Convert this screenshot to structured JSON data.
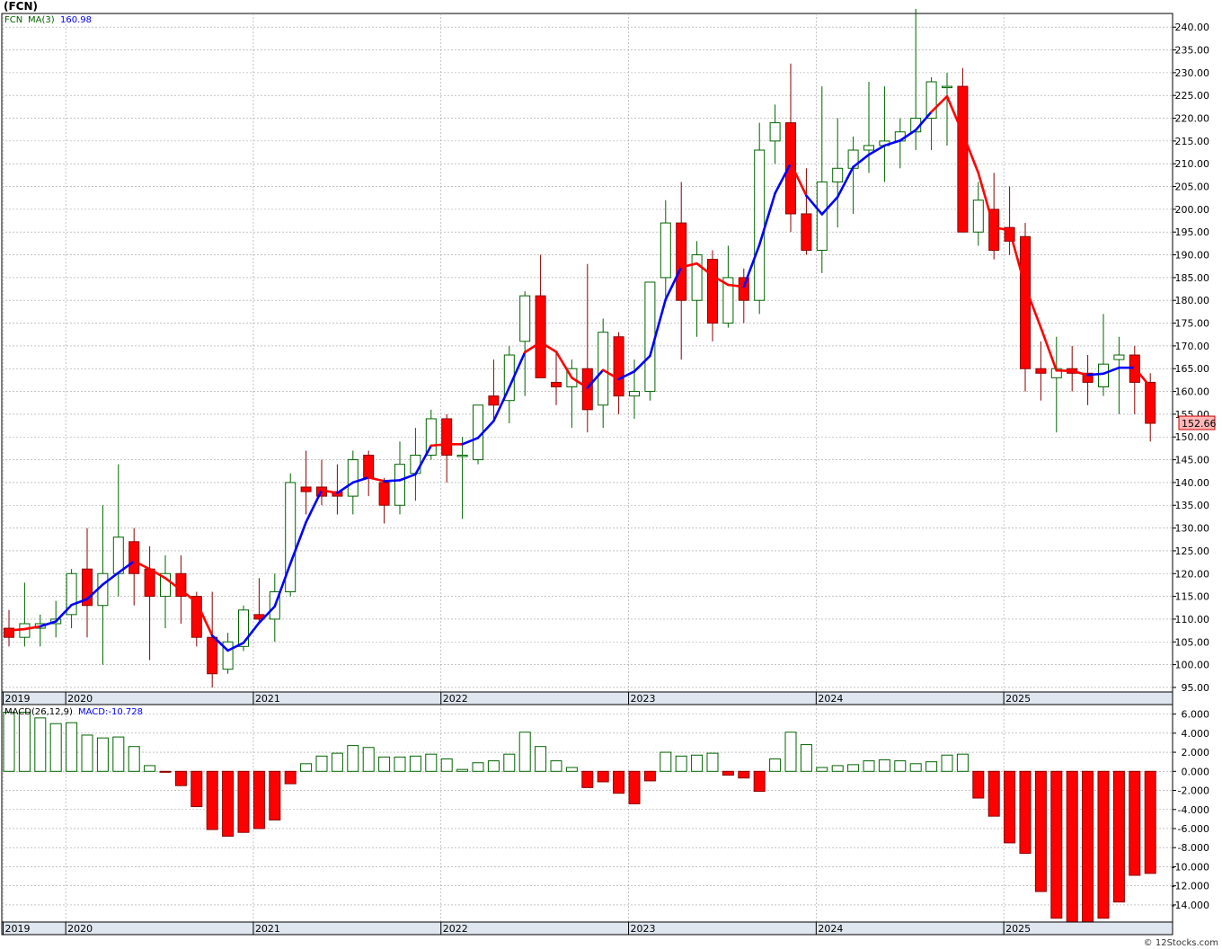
{
  "symbol_title": "(FCN)",
  "watermark": "© 12Stocks.com",
  "colors": {
    "up_fill": "#ffffff",
    "up_stroke": "#006400",
    "down_fill": "#ff0000",
    "down_stroke": "#8b0000",
    "wick": "#006400",
    "ma_up": "#0000ff",
    "ma_down": "#ff0000",
    "grid": "#a0a0a0",
    "last_price_bg": "#ffb6b6"
  },
  "chart_data": [
    {
      "type": "candlestick",
      "name": "price",
      "legend": {
        "symbol": "FCN",
        "ma_label": "MA(3)",
        "ma_value": "160.98"
      },
      "last_price_label": "152.66",
      "y_ticks": [
        "95.00",
        "100.00",
        "105.00",
        "110.00",
        "115.00",
        "120.00",
        "125.00",
        "130.00",
        "135.00",
        "140.00",
        "145.00",
        "150.00",
        "155.00",
        "160.00",
        "165.00",
        "170.00",
        "175.00",
        "180.00",
        "185.00",
        "190.00",
        "195.00",
        "200.00",
        "205.00",
        "210.00",
        "215.00",
        "220.00",
        "225.00",
        "230.00",
        "235.00",
        "240.00"
      ],
      "ylim": [
        94,
        243
      ],
      "x_labels": [
        "2019",
        "2020",
        "2021",
        "2022",
        "2023",
        "2024",
        "2025"
      ],
      "x_label_index": [
        -0.4,
        3.6,
        15.6,
        27.6,
        39.6,
        51.6,
        63.6
      ],
      "candles": [
        [
          108,
          112,
          104,
          106
        ],
        [
          106,
          118,
          104,
          109
        ],
        [
          108,
          111,
          104,
          109
        ],
        [
          109,
          114,
          106,
          110
        ],
        [
          111,
          121,
          108,
          120
        ],
        [
          121,
          130,
          106,
          113
        ],
        [
          113,
          135,
          100,
          120
        ],
        [
          120,
          144,
          115,
          128
        ],
        [
          127,
          130,
          113,
          120
        ],
        [
          121,
          126,
          101,
          115
        ],
        [
          115,
          124,
          108,
          120
        ],
        [
          120,
          124,
          109,
          115
        ],
        [
          115,
          116,
          104,
          106
        ],
        [
          106,
          116,
          95,
          98
        ],
        [
          99,
          107,
          98,
          105
        ],
        [
          104,
          113,
          103,
          112
        ],
        [
          111,
          119,
          109,
          110
        ],
        [
          110,
          120,
          105,
          116
        ],
        [
          116,
          142,
          115,
          140
        ],
        [
          139,
          147,
          133,
          138
        ],
        [
          139,
          145,
          135,
          137
        ],
        [
          138,
          144,
          133,
          137
        ],
        [
          137,
          147,
          133,
          145
        ],
        [
          146,
          147,
          137,
          141
        ],
        [
          140,
          141,
          131,
          135
        ],
        [
          135,
          149,
          133,
          144
        ],
        [
          142,
          152,
          136,
          146
        ],
        [
          146,
          156,
          145,
          154
        ],
        [
          154,
          155,
          140,
          146
        ],
        [
          146,
          150,
          132,
          146
        ],
        [
          145,
          157,
          144,
          157
        ],
        [
          159,
          167,
          154,
          157
        ],
        [
          158,
          170,
          153,
          168
        ],
        [
          171,
          182,
          159,
          181
        ],
        [
          181,
          190,
          163,
          163
        ],
        [
          162,
          169,
          157,
          161
        ],
        [
          161,
          167,
          152,
          165
        ],
        [
          165,
          188,
          151,
          156
        ],
        [
          157,
          176,
          152,
          173
        ],
        [
          172,
          173,
          155,
          159
        ],
        [
          159,
          167,
          154,
          160
        ],
        [
          160,
          184,
          158,
          184
        ],
        [
          185,
          202,
          180,
          197
        ],
        [
          197,
          206,
          167,
          180
        ],
        [
          180,
          193,
          172,
          190
        ],
        [
          189,
          191,
          171,
          175
        ],
        [
          175,
          192,
          174,
          185
        ],
        [
          185,
          187,
          175,
          180
        ],
        [
          180,
          219,
          177,
          213
        ],
        [
          215,
          223,
          210,
          219
        ],
        [
          219,
          232,
          195,
          199
        ],
        [
          199,
          209,
          190,
          191
        ],
        [
          191,
          227,
          186,
          206
        ],
        [
          206,
          220,
          196,
          209
        ],
        [
          209,
          216,
          199,
          213
        ],
        [
          213,
          228,
          208,
          214
        ],
        [
          214,
          227,
          206,
          215
        ],
        [
          215,
          220,
          209,
          217
        ],
        [
          217,
          244,
          213,
          220
        ],
        [
          220,
          229,
          213,
          228
        ],
        [
          227,
          230,
          214,
          227
        ],
        [
          227,
          231,
          195,
          195
        ],
        [
          195,
          206,
          192,
          202
        ],
        [
          200,
          208,
          189,
          191
        ],
        [
          196,
          205,
          190,
          193
        ],
        [
          194,
          197,
          160,
          165
        ],
        [
          165,
          171,
          158,
          164
        ],
        [
          163,
          172,
          151,
          165
        ],
        [
          165,
          170,
          160,
          164
        ],
        [
          164,
          168,
          157,
          162
        ],
        [
          161,
          177,
          159,
          166
        ],
        [
          167,
          172,
          155,
          168
        ],
        [
          168,
          170,
          155,
          162
        ],
        [
          162,
          164,
          149,
          153
        ]
      ],
      "ma3": [
        107.5,
        107.8,
        108.4,
        109.5,
        113.1,
        114.4,
        117.6,
        120.2,
        122.7,
        121.0,
        119.0,
        116.4,
        113.7,
        106.4,
        103.1,
        104.8,
        109.2,
        112.8,
        122.2,
        131.3,
        138.3,
        137.7,
        140.0,
        141.1,
        140.3,
        140.5,
        141.8,
        148.1,
        148.4,
        148.4,
        149.8,
        153.5,
        160.9,
        168.6,
        170.8,
        168.7,
        163.0,
        160.8,
        164.7,
        162.7,
        164.4,
        167.8,
        180.2,
        187.3,
        188.1,
        185.4,
        183.4,
        183.0,
        192.2,
        203.5,
        210.1,
        203.0,
        198.9,
        202.7,
        209.3,
        212.0,
        214.0,
        215.1,
        217.4,
        221.4,
        224.8,
        216.7,
        208.0,
        196.0,
        195.4,
        183.0,
        174.0,
        164.6,
        164.5,
        163.6,
        163.9,
        165.2,
        165.2,
        160.98
      ],
      "ma_color": [
        "down",
        "down",
        "down",
        "up",
        "up",
        "up",
        "up",
        "up",
        "up",
        "down",
        "down",
        "down",
        "down",
        "down",
        "up",
        "up",
        "up",
        "up",
        "up",
        "up",
        "up",
        "down",
        "up",
        "up",
        "down",
        "up",
        "up",
        "up",
        "down",
        "down",
        "up",
        "up",
        "up",
        "up",
        "down",
        "down",
        "down",
        "down",
        "up",
        "down",
        "up",
        "up",
        "up",
        "up",
        "down",
        "down",
        "down",
        "down",
        "up",
        "up",
        "up",
        "down",
        "up",
        "up",
        "up",
        "up",
        "up",
        "up",
        "up",
        "up",
        "down",
        "down",
        "down",
        "down",
        "down",
        "down",
        "down",
        "down",
        "down",
        "down",
        "up",
        "up",
        "up",
        "down",
        "down"
      ]
    },
    {
      "type": "bar",
      "name": "macd",
      "legend": {
        "label": "MACD(26,12,9)",
        "value_label": "MACD:-10.728"
      },
      "y_ticks": [
        "-14.000",
        "-12.000",
        "-10.000",
        "-8.000",
        "-6.000",
        "-4.000",
        "-2.000",
        "0.000",
        "2.000",
        "4.000",
        "6.000"
      ],
      "ylim": [
        -15.8,
        7.0
      ],
      "values": [
        6.2,
        6.2,
        5.6,
        5.0,
        5.1,
        3.8,
        3.5,
        3.6,
        2.6,
        0.6,
        -0.1,
        -1.5,
        -3.7,
        -6.1,
        -6.8,
        -6.4,
        -6.0,
        -5.1,
        -1.3,
        0.8,
        1.6,
        1.9,
        2.7,
        2.5,
        1.5,
        1.5,
        1.6,
        1.8,
        1.3,
        0.2,
        0.9,
        1.1,
        1.8,
        4.1,
        2.6,
        1.1,
        0.4,
        -1.7,
        -1.1,
        -2.3,
        -3.4,
        -1.0,
        2.0,
        1.6,
        1.7,
        1.9,
        -0.4,
        -0.7,
        -2.1,
        1.3,
        4.1,
        2.8,
        0.4,
        0.6,
        0.7,
        1.1,
        1.2,
        1.1,
        0.8,
        1.0,
        1.7,
        1.8,
        -2.8,
        -4.7,
        -7.5,
        -8.6,
        -12.6,
        -15.4,
        -15.8,
        -15.8,
        -15.4,
        -13.7,
        -10.9,
        -10.7
      ]
    }
  ]
}
